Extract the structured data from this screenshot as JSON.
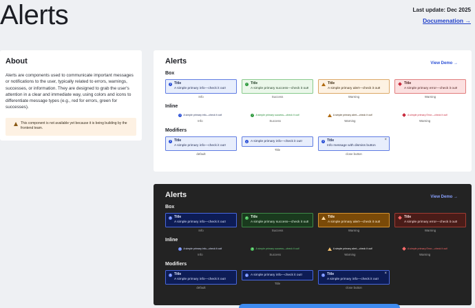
{
  "header": {
    "title": "Alerts",
    "last_update": "Last update: Dec 2025",
    "doc_link": "Documenation →"
  },
  "about": {
    "title": "About",
    "body": "Alerts are components used to communicate important messages or notifications to the user, typically related to errors, warnings, successes, or information. They are designed to grab the user's attention in a clear and immediate way, using colors and icons to differentiate message types (e.g., red for errors, green for successes).",
    "warning": "This component is not available yet because it is being building by the frontend team."
  },
  "panels": {
    "light": {
      "title": "Alerts",
      "view_demo": "View Demo →",
      "box_label": "Box",
      "inline_label": "Inline",
      "modifiers_label": "Modifiers"
    },
    "dark": {
      "title": "Alerts",
      "view_demo": "View Demo →",
      "box_label": "Box",
      "inline_label": "Inline",
      "modifiers_label": "Modifiers"
    }
  },
  "box": [
    {
      "title": "Title",
      "msg": "A simple primary info—check it out!",
      "caption": "Info"
    },
    {
      "title": "Title",
      "msg": "A simple primary success—check it out!",
      "caption": "Success"
    },
    {
      "title": "Title",
      "msg": "A simple primary alert—check it out!",
      "caption": "Warning"
    },
    {
      "title": "Title",
      "msg": "A simple primary error—check it out!",
      "caption": "Warning"
    }
  ],
  "inline": [
    {
      "msg": "A simple primary info—check it out!",
      "caption": "Info"
    },
    {
      "msg": "A simple primary success—check it out!",
      "caption": "Success"
    },
    {
      "msg": "A simple primary alert—check it out!",
      "caption": "Warning"
    },
    {
      "msg": "A simple primary Error—check it out!",
      "caption": "Warning"
    }
  ],
  "modifiers": [
    {
      "title": "Title",
      "msg": "A simple primary info—check it out!",
      "caption": "default"
    },
    {
      "msg": "A simple primary info—check it out!",
      "caption": "Title"
    },
    {
      "title": "Title",
      "msg": "Info message with dismiss button",
      "caption": "close button",
      "close": "×"
    }
  ],
  "modifiers_dark": [
    {
      "title": "Title",
      "msg": "A simple primary info—check it out!",
      "caption": "default"
    },
    {
      "msg": "A simple primary info—check it out!",
      "caption": "Title"
    },
    {
      "title": "Title",
      "msg": "A simple primary info—check it out!",
      "caption": "close button",
      "close": "×"
    }
  ],
  "icons": {
    "info": "info-icon",
    "success": "check-circle-icon",
    "warning": "warning-triangle-icon",
    "error": "error-diamond-icon"
  },
  "colors": {
    "accent": "#2a4fd6",
    "success": "#2e9a3e",
    "warning": "#b06a10",
    "error": "#c8283b"
  }
}
